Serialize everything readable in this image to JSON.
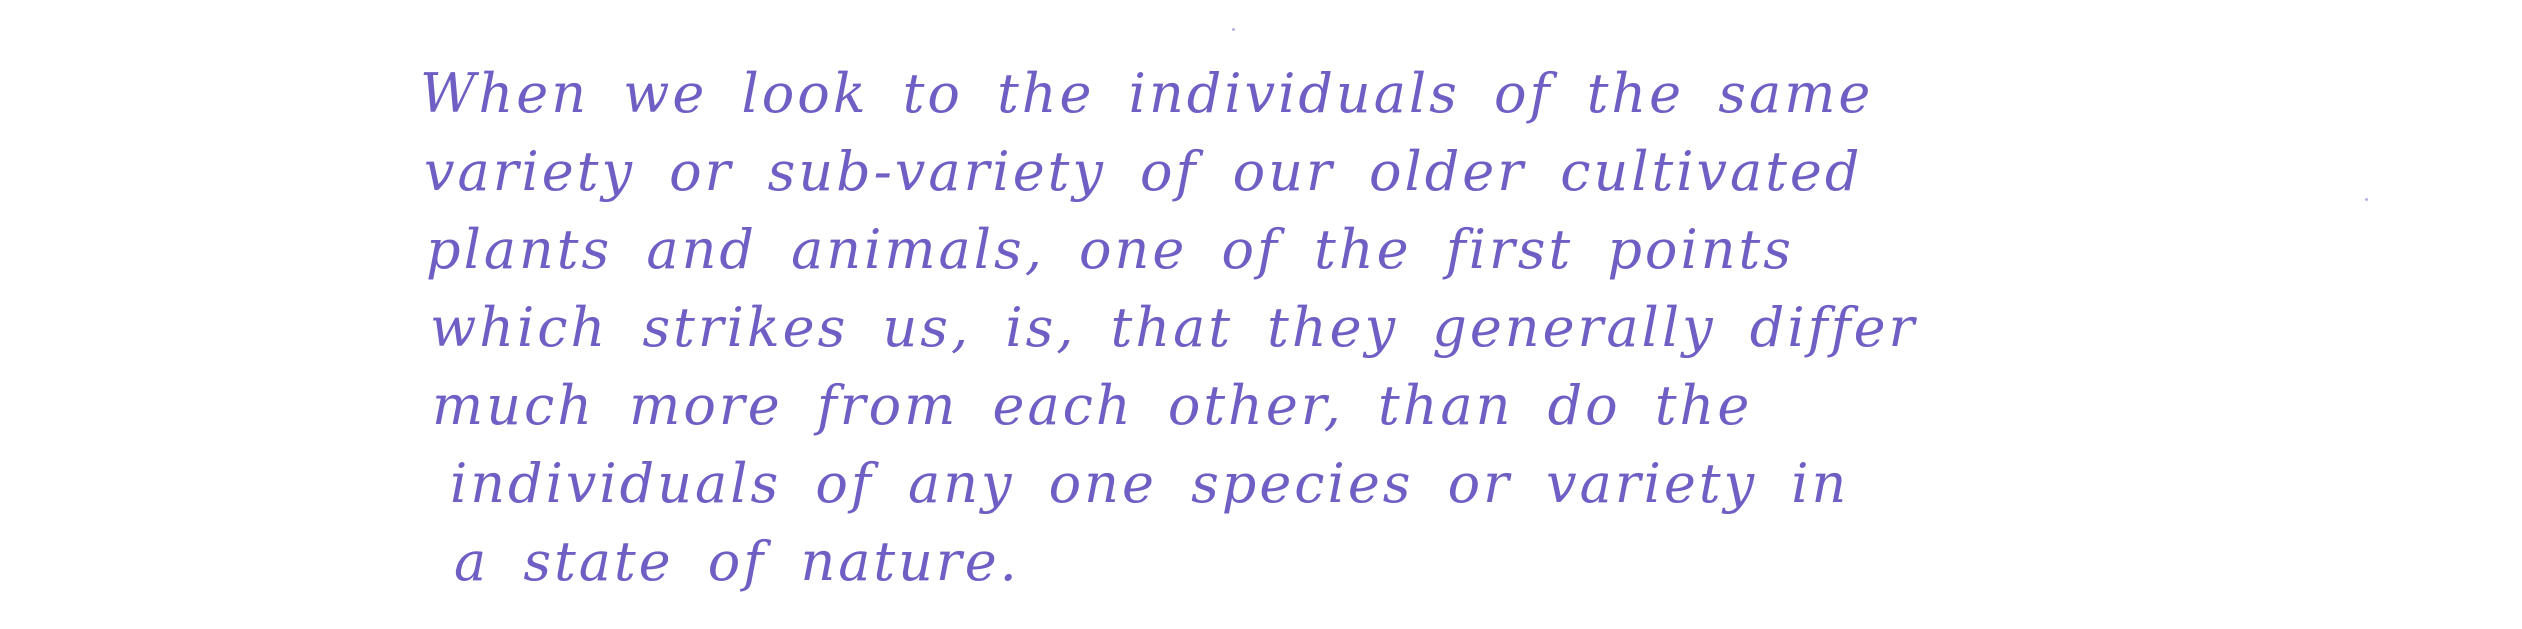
{
  "document": {
    "ink_color": "#6f5fc4",
    "paper_color": "#ffffff",
    "lines": [
      "When we look to the individuals of the same",
      "variety or sub-variety of our older cultivated",
      "plants and animals, one of the first points",
      "which strikes us, is, that they generally differ",
      "much more from each other, than do the",
      "individuals of any one species or variety in",
      "a state of nature."
    ]
  }
}
